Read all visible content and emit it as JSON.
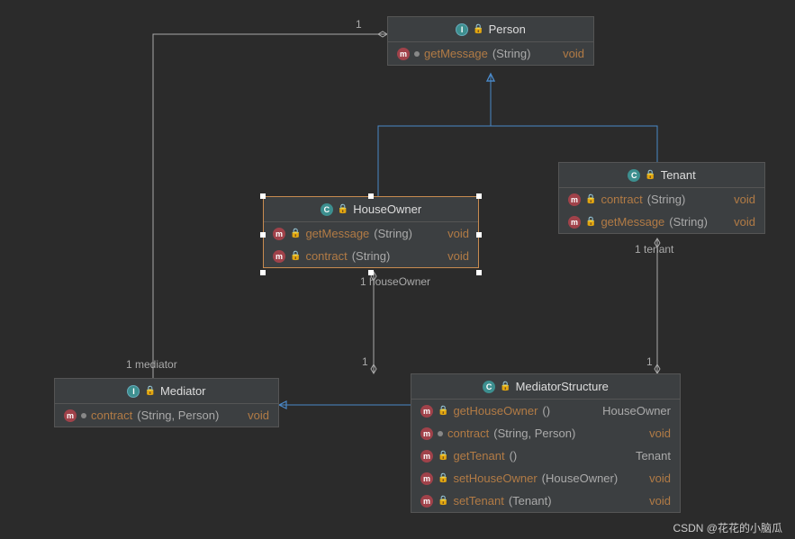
{
  "classes": {
    "person": {
      "name": "Person",
      "type": "interface",
      "methods": [
        {
          "name": "getMessage",
          "params": "(String)",
          "ret": "void",
          "retClass": "ret"
        }
      ]
    },
    "tenant": {
      "name": "Tenant",
      "type": "class",
      "methods": [
        {
          "name": "contract",
          "params": "(String)",
          "ret": "void",
          "retClass": "ret"
        },
        {
          "name": "getMessage",
          "params": "(String)",
          "ret": "void",
          "retClass": "ret"
        }
      ]
    },
    "houseOwner": {
      "name": "HouseOwner",
      "type": "class",
      "methods": [
        {
          "name": "getMessage",
          "params": "(String)",
          "ret": "void",
          "retClass": "ret"
        },
        {
          "name": "contract",
          "params": "(String)",
          "ret": "void",
          "retClass": "ret"
        }
      ]
    },
    "mediator": {
      "name": "Mediator",
      "type": "interface",
      "methods": [
        {
          "name": "contract",
          "params": "(String, Person)",
          "ret": "void",
          "retClass": "ret"
        }
      ]
    },
    "mediatorStructure": {
      "name": "MediatorStructure",
      "type": "class",
      "methods": [
        {
          "name": "getHouseOwner",
          "params": "()",
          "ret": "HouseOwner",
          "retClass": "ret ty"
        },
        {
          "name": "contract",
          "params": "(String, Person)",
          "ret": "void",
          "retClass": "ret"
        },
        {
          "name": "getTenant",
          "params": "()",
          "ret": "Tenant",
          "retClass": "ret ty"
        },
        {
          "name": "setHouseOwner",
          "params": "(HouseOwner)",
          "ret": "void",
          "retClass": "ret"
        },
        {
          "name": "setTenant",
          "params": "(Tenant)",
          "ret": "void",
          "retClass": "ret"
        }
      ]
    }
  },
  "labels": {
    "m1": "1",
    "houseOwner": "1 houseOwner",
    "tenant": "1 tenant",
    "mediator": "1 mediator"
  },
  "watermark": "CSDN @花花的小脑瓜"
}
